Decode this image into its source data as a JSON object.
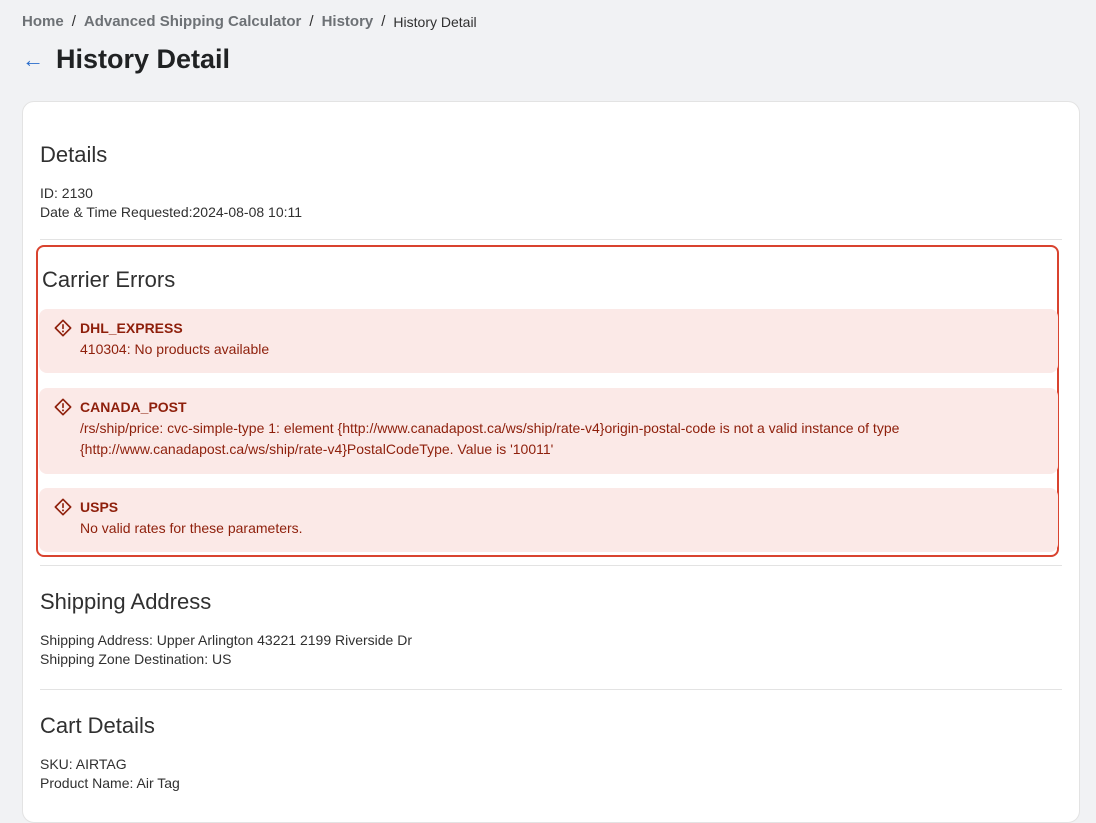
{
  "breadcrumb": {
    "home": "Home",
    "calculator": "Advanced Shipping Calculator",
    "history": "History",
    "current": "History Detail",
    "separator": "/"
  },
  "page": {
    "back_icon": "arrow-left-icon",
    "title": "History Detail"
  },
  "details": {
    "heading": "Details",
    "id_line": "ID: 2130",
    "datetime_line": "Date & Time Requested:2024-08-08 10:11"
  },
  "carrier_errors": {
    "heading": "Carrier Errors",
    "highlight_color": "#d9432f",
    "items": [
      {
        "carrier": "DHL_EXPRESS",
        "message": "410304: No products available",
        "icon": "alert-diamond-icon"
      },
      {
        "carrier": "CANADA_POST",
        "message": "/rs/ship/price: cvc-simple-type 1: element {http://www.canadapost.ca/ws/ship/rate-v4}origin-postal-code is not a valid instance of type {http://www.canadapost.ca/ws/ship/rate-v4}PostalCodeType. Value is '10011'",
        "icon": "alert-diamond-icon"
      },
      {
        "carrier": "USPS",
        "message": "No valid rates for these parameters.",
        "icon": "alert-diamond-icon"
      }
    ]
  },
  "shipping_address": {
    "heading": "Shipping Address",
    "address_line": "Shipping Address: Upper Arlington 43221 2199 Riverside Dr",
    "zone_line": "Shipping Zone Destination: US"
  },
  "cart_details": {
    "heading": "Cart Details",
    "sku_line": "SKU: AIRTAG",
    "product_line": "Product Name: Air Tag"
  }
}
